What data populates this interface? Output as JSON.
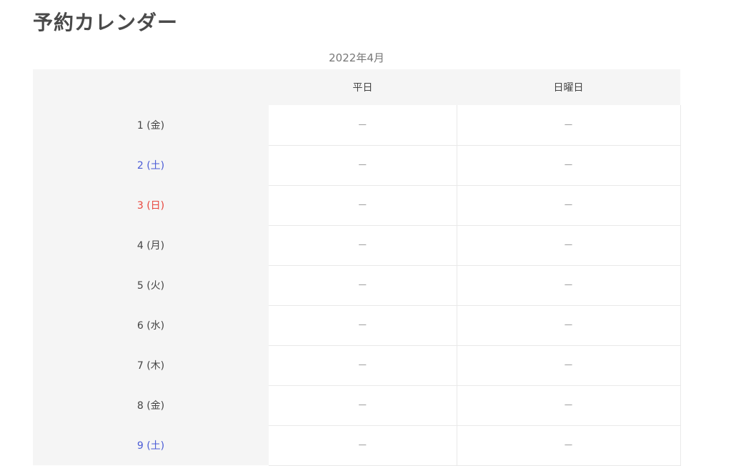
{
  "page": {
    "title": "予約カレンダー",
    "month": "2022年4月"
  },
  "calendar": {
    "columns": [
      "",
      "平日",
      "日曜日"
    ],
    "rows": [
      {
        "day": "1 (金)",
        "weekday": "－",
        "sunday": "－",
        "kind": "normal"
      },
      {
        "day": "2 (土)",
        "weekday": "－",
        "sunday": "－",
        "kind": "sat"
      },
      {
        "day": "3 (日)",
        "weekday": "－",
        "sunday": "－",
        "kind": "sun"
      },
      {
        "day": "4 (月)",
        "weekday": "－",
        "sunday": "－",
        "kind": "normal"
      },
      {
        "day": "5 (火)",
        "weekday": "－",
        "sunday": "－",
        "kind": "normal"
      },
      {
        "day": "6 (水)",
        "weekday": "－",
        "sunday": "－",
        "kind": "normal"
      },
      {
        "day": "7 (木)",
        "weekday": "－",
        "sunday": "－",
        "kind": "normal"
      },
      {
        "day": "8 (金)",
        "weekday": "－",
        "sunday": "－",
        "kind": "normal"
      },
      {
        "day": "9 (土)",
        "weekday": "－",
        "sunday": "－",
        "kind": "sat"
      }
    ]
  },
  "colors": {
    "saturday": "#4a5bd6",
    "sunday": "#e8453c",
    "header_bg": "#f5f5f5"
  }
}
